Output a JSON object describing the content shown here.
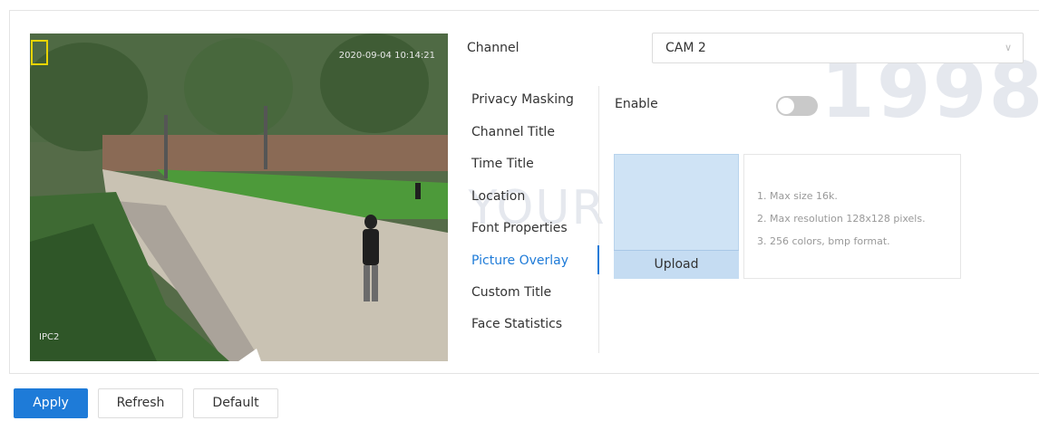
{
  "osd": {
    "timestamp": "2020-09-04 10:14:21",
    "camera_name": "IPC2"
  },
  "channel": {
    "label": "Channel",
    "value": "CAM 2"
  },
  "menu": {
    "items": [
      {
        "label": "Privacy Masking"
      },
      {
        "label": "Channel Title"
      },
      {
        "label": "Time Title"
      },
      {
        "label": "Location"
      },
      {
        "label": "Font Properties"
      },
      {
        "label": "Picture Overlay",
        "active": true
      },
      {
        "label": "Custom Title"
      },
      {
        "label": "Face Statistics"
      }
    ]
  },
  "enable": {
    "label": "Enable",
    "on": false
  },
  "upload": {
    "label": "Upload",
    "hints": [
      "1. Max size 16k.",
      "2. Max resolution 128x128 pixels.",
      "3. 256 colors, bmp format."
    ]
  },
  "actions": {
    "apply": "Apply",
    "refresh": "Refresh",
    "default": "Default"
  },
  "watermark": {
    "number": "1998",
    "slogan": "WE SECURE YOUR LIFE"
  },
  "colors": {
    "accent": "#1e7bd8",
    "toggle_off": "#c9c9c9",
    "upload_area": "#cfe3f5"
  }
}
